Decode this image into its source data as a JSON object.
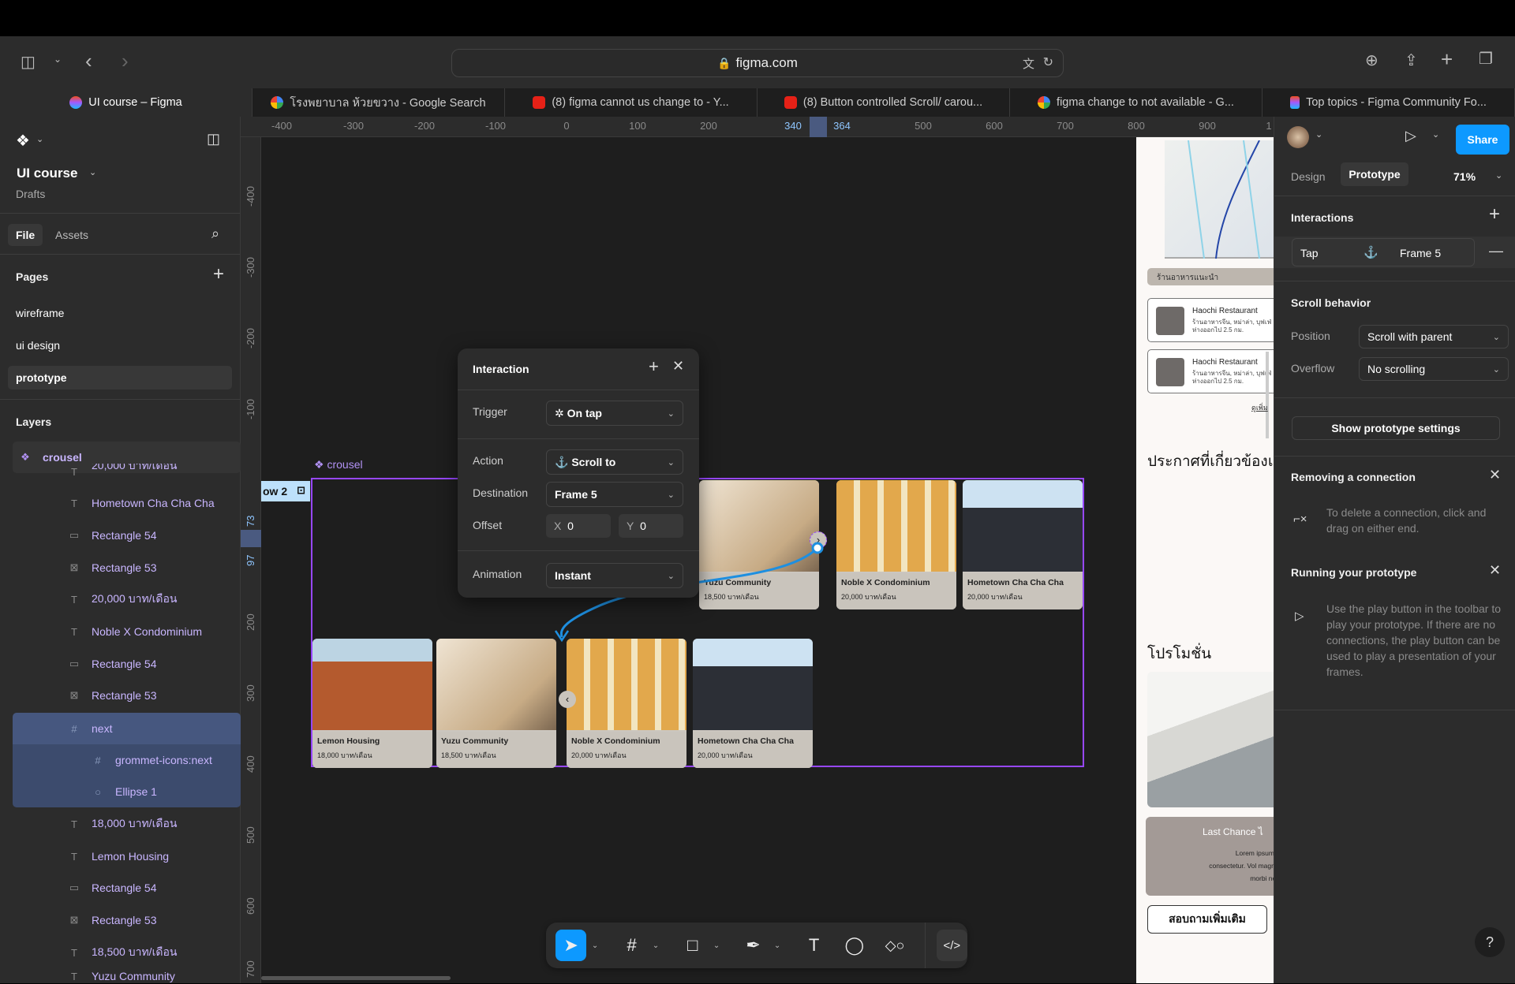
{
  "browser": {
    "url": "figma.com",
    "tabs": [
      {
        "label": "UI course – Figma",
        "icon": "figma-icon",
        "active": true
      },
      {
        "label": "โรงพยาบาล ห้วยขวาง - Google Search",
        "icon": "google-icon"
      },
      {
        "label": "(8) figma cannot us change to - Y...",
        "icon": "youtube-icon"
      },
      {
        "label": "(8) Button controlled Scroll/ carou...",
        "icon": "youtube-icon"
      },
      {
        "label": "figma change to not available - G...",
        "icon": "google-icon"
      },
      {
        "label": "Top topics - Figma Community Fo...",
        "icon": "figma-icon"
      }
    ]
  },
  "left": {
    "file_name": "UI course",
    "location": "Drafts",
    "tabs": {
      "file": "File",
      "assets": "Assets"
    },
    "pages_title": "Pages",
    "pages": [
      "wireframe",
      "ui design",
      "prototype"
    ],
    "selected_page": "prototype",
    "layers_title": "Layers",
    "layers": [
      {
        "name": "crousel",
        "type": "component",
        "indent": 0,
        "selected": false
      },
      {
        "name": "20,000 บาท/เดือน",
        "type": "text",
        "indent": 1,
        "partial": true
      },
      {
        "name": "Hometown Cha Cha Cha",
        "type": "text",
        "indent": 1
      },
      {
        "name": "Rectangle 54",
        "type": "rect",
        "indent": 1
      },
      {
        "name": "Rectangle 53",
        "type": "image",
        "indent": 1
      },
      {
        "name": "20,000 บาท/เดือน",
        "type": "text",
        "indent": 1
      },
      {
        "name": "Noble X Condominium",
        "type": "text",
        "indent": 1
      },
      {
        "name": "Rectangle 54",
        "type": "rect",
        "indent": 1
      },
      {
        "name": "Rectangle 53",
        "type": "image",
        "indent": 1
      },
      {
        "name": "next",
        "type": "frame",
        "indent": 1,
        "selected": true
      },
      {
        "name": "grommet-icons:next",
        "type": "frame",
        "indent": 2,
        "selected_child": true
      },
      {
        "name": "Ellipse 1",
        "type": "ellipse",
        "indent": 2,
        "selected_child": true
      },
      {
        "name": "18,000 บาท/เดือน",
        "type": "text",
        "indent": 1
      },
      {
        "name": "Lemon Housing",
        "type": "text",
        "indent": 1
      },
      {
        "name": "Rectangle 54",
        "type": "rect",
        "indent": 1
      },
      {
        "name": "Rectangle 53",
        "type": "image",
        "indent": 1
      },
      {
        "name": "18,500 บาท/เดือน",
        "type": "text",
        "indent": 1
      },
      {
        "name": "Yuzu Community",
        "type": "text",
        "indent": 1,
        "partial": true
      }
    ]
  },
  "rulers": {
    "top": [
      "-400",
      "-300",
      "-200",
      "-100",
      "0",
      "100",
      "200",
      "340",
      "364",
      "500",
      "600",
      "700",
      "800",
      "900",
      "1"
    ],
    "left": [
      "-400",
      "-300",
      "-200",
      "-100",
      "73",
      "97",
      "200",
      "300",
      "400",
      "500",
      "600",
      "700"
    ]
  },
  "canvas": {
    "component_label": "crousel",
    "frame_tag": "ow 2",
    "cards_top": [
      {
        "name": "Yuzu Community",
        "price": "18,500 บาท/เดือน",
        "img": "room"
      },
      {
        "name": "Noble X Condominium",
        "price": "20,000 บาท/เดือน",
        "img": "yellow"
      },
      {
        "name": "Hometown Cha Cha Cha",
        "price": "20,000 บาท/เดือน",
        "img": "modern"
      }
    ],
    "cards_bottom": [
      {
        "name": "Lemon Housing",
        "price": "18,000 บาท/เดือน",
        "img": "brick"
      },
      {
        "name": "Yuzu Community",
        "price": "18,500 บาท/เดือน",
        "img": "room"
      },
      {
        "name": "Noble X Condominium",
        "price": "20,000 บาท/เดือน",
        "img": "yellow"
      },
      {
        "name": "Hometown Cha Cha Cha",
        "price": "20,000 บาท/เดือน",
        "img": "modern"
      }
    ]
  },
  "interaction_popup": {
    "title": "Interaction",
    "trigger_label": "Trigger",
    "trigger_value": "On tap",
    "action_label": "Action",
    "action_value": "Scroll to",
    "destination_label": "Destination",
    "destination_value": "Frame 5",
    "offset_label": "Offset",
    "offset_x_label": "X",
    "offset_x": "0",
    "offset_y_label": "Y",
    "offset_y": "0",
    "animation_label": "Animation",
    "animation_value": "Instant"
  },
  "preview": {
    "section1": "ร้านอาหารแนะนำ",
    "restaurants": [
      {
        "name": "Haochi Restaurant",
        "desc": "ร้านอาหารจีน, หม่าล่า, บุฟเฟ่",
        "dist": "ห่างออกไป 2.5 กม."
      },
      {
        "name": "Haochi Restaurant",
        "desc": "ร้านอาหารจีน, หม่าล่า, บุฟเฟ่",
        "dist": "ห่างออกไป 2.5 กม."
      }
    ],
    "more_link": "ดูเพิ่ม",
    "announce_title": "ประกาศที่เกี่ยวข้องแ",
    "promo_title": "โปรโมชั่น",
    "promo_card_title": "Last Chance ไ",
    "promo_card_body": "Lorem ipsum d consectetur. Vol magnis morbi neq",
    "inquire_button": "สอบถามเพิ่มเติม"
  },
  "right": {
    "share": "Share",
    "tabs": {
      "design": "Design",
      "prototype": "Prototype"
    },
    "zoom": "71%",
    "interactions_title": "Interactions",
    "interaction_item": {
      "trigger": "Tap",
      "target": "Frame 5"
    },
    "scroll_title": "Scroll behavior",
    "position_label": "Position",
    "position_value": "Scroll with parent",
    "overflow_label": "Overflow",
    "overflow_value": "No scrolling",
    "settings_button": "Show prototype settings",
    "tip1_title": "Removing a connection",
    "tip1_body": "To delete a connection, click and drag on either end.",
    "tip2_title": "Running your prototype",
    "tip2_body": "Use the play button in the toolbar to play your prototype. If there are no connections, the play button can be used to play a presentation of your frames."
  },
  "help": "?"
}
